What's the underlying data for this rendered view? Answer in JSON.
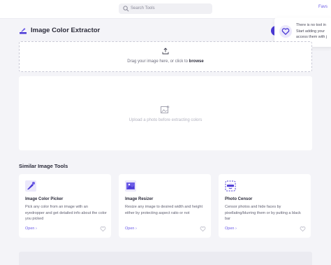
{
  "header": {
    "search_placeholder": "Search Tools",
    "favs_label": "Favs"
  },
  "tooltip": {
    "line1": "There is no tool in",
    "line2": "Start adding your",
    "line3": "access them with j"
  },
  "tool": {
    "title": "Image Color Extractor",
    "dropzone_prefix": "Drag your image here, or click to ",
    "dropzone_link": "browse",
    "preview_placeholder": "Upload a photo before extracting colors"
  },
  "similar": {
    "heading": "Similar Image Tools",
    "cards": [
      {
        "title": "Image Color Picker",
        "desc": "Pick any color from an image with an eyedropper and get detailed info about the color you picked",
        "open": "Open ›",
        "icon": "color-picker-icon"
      },
      {
        "title": "Image Resizer",
        "desc": "Resize any image to desired width and height either by protecting aspect ratio or not",
        "open": "Open ›",
        "icon": "image-resize-icon"
      },
      {
        "title": "Photo Censor",
        "desc": "Censor photos and hide faces by pixellating/blurring them or by putting a black bar",
        "open": "Open ›",
        "icon": "censor-face-icon"
      }
    ]
  },
  "colors": {
    "accent": "#6c5ce7",
    "accent_dark": "#4b3ad6",
    "background": "#f4f4f8"
  }
}
